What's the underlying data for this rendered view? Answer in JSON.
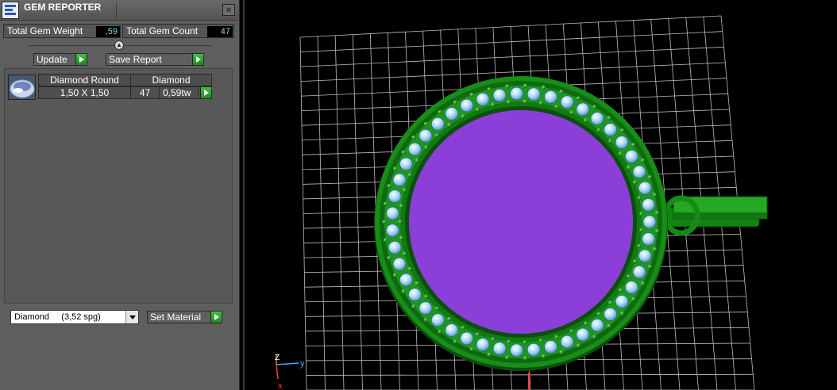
{
  "window": {
    "title": "GEM REPORTER",
    "close_icon": "close-icon"
  },
  "totals": {
    "weight_label": "Total Gem Weight",
    "weight_value": ",59",
    "count_label": "Total Gem Count",
    "count_value": "47"
  },
  "actions": {
    "update_label": "Update",
    "save_report_label": "Save Report"
  },
  "gems": {
    "columns": [
      {
        "name": "Diamond Round",
        "value": "1,50 X 1,50"
      },
      {
        "name": "Diamond"
      }
    ],
    "count": "47",
    "weight": "0,59tw",
    "icon": "oval-gem-icon"
  },
  "material": {
    "selected": "Diamond     (3,52 spg)",
    "set_label": "Set Material"
  },
  "viewport": {
    "axis_labels": {
      "z": "Z",
      "y": "y",
      "x": "x"
    },
    "colors": {
      "metal": "#1f8f1f",
      "stone": "#a9d8ff",
      "center": "#8b3fd8",
      "grid": "#bdbdbd",
      "go_button": "#2fa32f"
    }
  }
}
